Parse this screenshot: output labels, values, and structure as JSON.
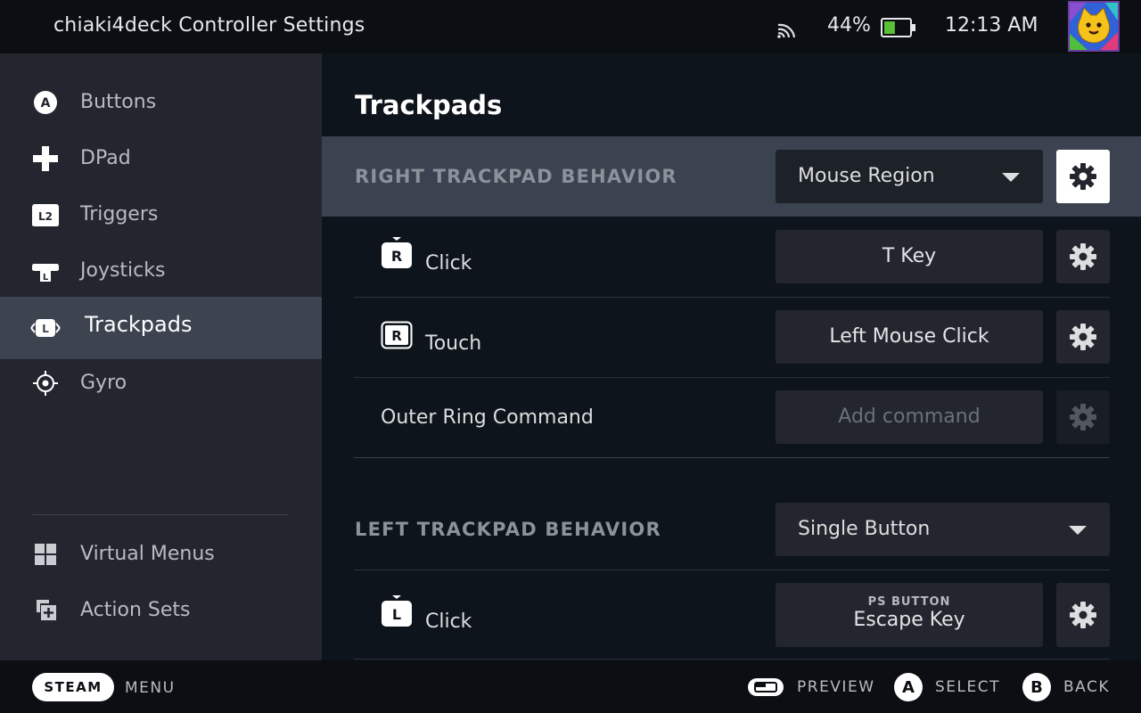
{
  "topbar": {
    "title": "chiaki4deck Controller Settings",
    "battery_percent": "44%",
    "battery_level": 0.44,
    "clock": "12:13 AM"
  },
  "sidebar": {
    "items": [
      {
        "label": "Buttons",
        "icon": "a-button-icon"
      },
      {
        "label": "DPad",
        "icon": "dpad-icon"
      },
      {
        "label": "Triggers",
        "icon": "l2-trigger-icon"
      },
      {
        "label": "Joysticks",
        "icon": "joystick-icon"
      },
      {
        "label": "Trackpads",
        "icon": "trackpad-icon",
        "active": true
      },
      {
        "label": "Gyro",
        "icon": "gyro-icon"
      }
    ],
    "secondary": [
      {
        "label": "Virtual Menus",
        "icon": "virtual-menus-icon"
      },
      {
        "label": "Action Sets",
        "icon": "action-sets-icon"
      }
    ]
  },
  "main": {
    "title": "Trackpads",
    "right_trackpad": {
      "label": "RIGHT TRACKPAD BEHAVIOR",
      "mode": "Mouse Region",
      "rows": [
        {
          "label": "Click",
          "key_icon": "R",
          "command": "T Key"
        },
        {
          "label": "Touch",
          "key_icon": "R",
          "command": "Left Mouse Click"
        },
        {
          "label": "Outer Ring Command",
          "command": "Add command"
        }
      ]
    },
    "left_trackpad": {
      "label": "LEFT TRACKPAD BEHAVIOR",
      "mode": "Single Button",
      "rows": [
        {
          "label": "Click",
          "key_icon": "L",
          "command_sub": "PS BUTTON",
          "command": "Escape Key"
        }
      ]
    }
  },
  "bottombar": {
    "steam": "STEAM",
    "menu": "MENU",
    "preview": "PREVIEW",
    "select_key": "A",
    "select": "SELECT",
    "back_key": "B",
    "back": "BACK"
  }
}
